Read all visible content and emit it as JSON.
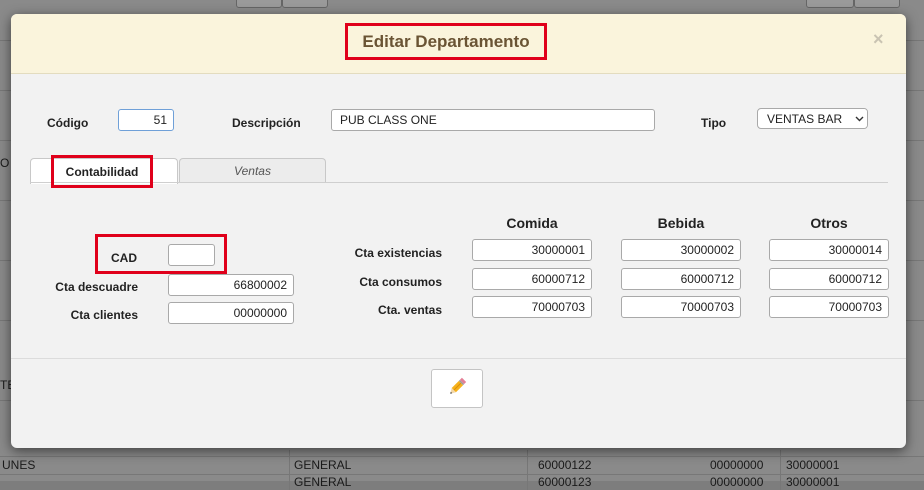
{
  "background": {
    "left_text_1": "O",
    "left_text_2": "TE",
    "bottom_row": [
      "UNES",
      "GENERAL",
      "60000122",
      "00000000",
      "30000001"
    ],
    "bottom_row2": [
      "GENERAL",
      "60000123",
      "00000000",
      "30000001"
    ]
  },
  "modal": {
    "title": "Editar Departamento",
    "close_symbol": "×"
  },
  "header_fields": {
    "codigo_label": "Código",
    "codigo_value": "51",
    "descripcion_label": "Descripción",
    "descripcion_value": "PUB CLASS ONE",
    "tipo_label": "Tipo",
    "tipo_value": "VENTAS BAR"
  },
  "tabs": [
    {
      "label": "Contabilidad",
      "active": true
    },
    {
      "label": "Ventas",
      "active": false
    }
  ],
  "left_fields": [
    {
      "label": "CAD",
      "value": ""
    },
    {
      "label": "Cta descuadre",
      "value": "66800002"
    },
    {
      "label": "Cta clientes",
      "value": "00000000"
    }
  ],
  "grid": {
    "columns": [
      "Comida",
      "Bebida",
      "Otros"
    ],
    "rows": [
      {
        "label": "Cta existencias",
        "values": [
          "30000001",
          "30000002",
          "30000014"
        ]
      },
      {
        "label": "Cta consumos",
        "values": [
          "60000712",
          "60000712",
          "60000712"
        ]
      },
      {
        "label": "Cta. ventas",
        "values": [
          "70000703",
          "70000703",
          "70000703"
        ]
      }
    ]
  },
  "footer": {
    "edit_icon": "pencil-icon"
  },
  "colors": {
    "highlight_red": "#e0001b",
    "header_bg": "#faf4dc",
    "title_color": "#6a5434"
  }
}
